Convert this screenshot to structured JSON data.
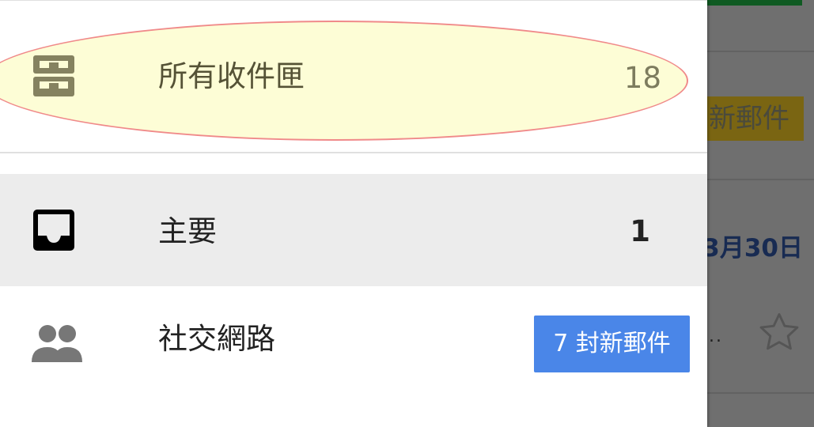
{
  "background": {
    "badge_text": "新郵件",
    "date_text": "3月30日",
    "ellipsis": "..",
    "star_icon": "star-outline-icon"
  },
  "drawer": {
    "items": [
      {
        "icon": "all-inbox-icon",
        "label": "所有收件匣",
        "count": "18",
        "highlighted": true
      },
      {
        "icon": "inbox-icon",
        "label": "主要",
        "count": "1",
        "selected": true
      },
      {
        "icon": "people-icon",
        "label": "社交網路",
        "badge": "7 封新郵件"
      }
    ]
  },
  "colors": {
    "badge_blue": "#4a86e8",
    "highlight_fill": "#fdfdd6",
    "highlight_stroke": "#f08a8a",
    "selected_row": "#ececec"
  }
}
